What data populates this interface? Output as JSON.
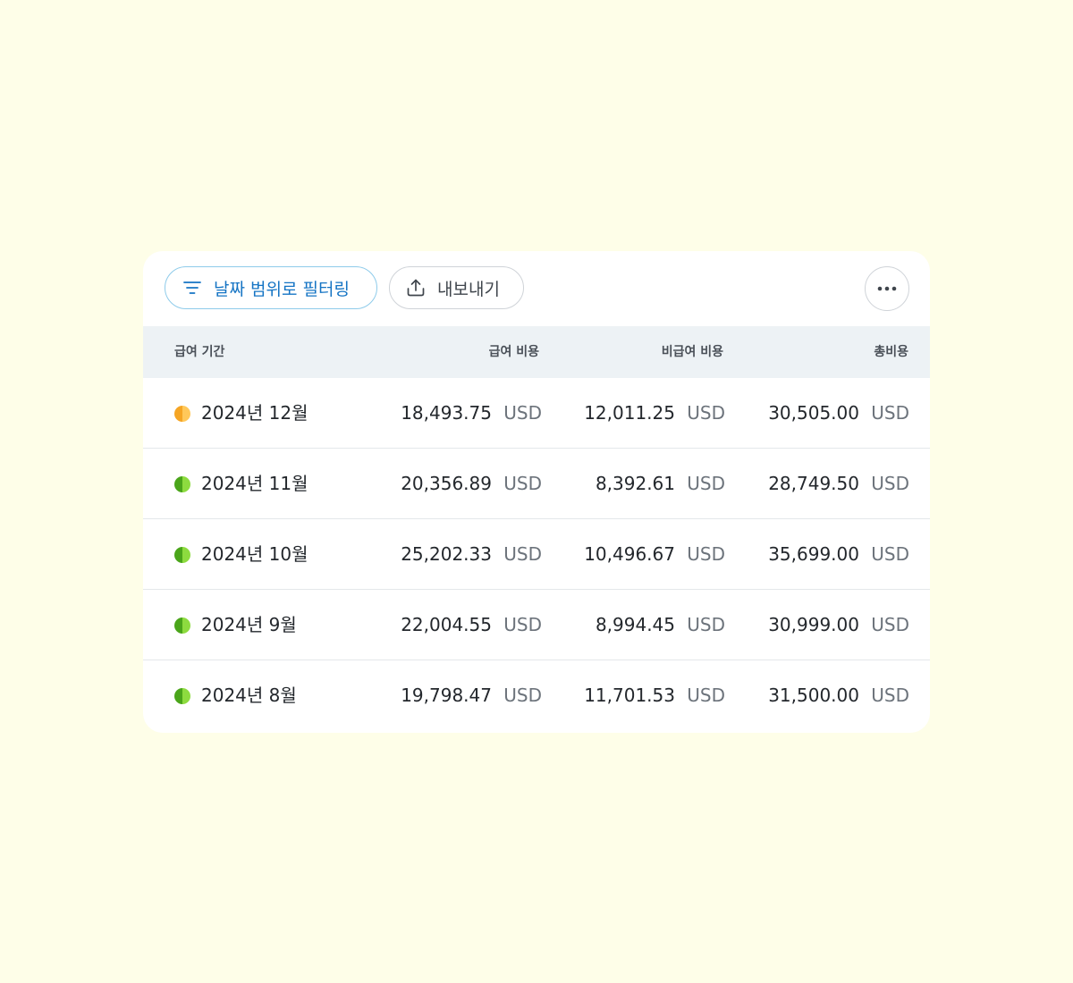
{
  "toolbar": {
    "filter_label": "날짜 범위로 필터링",
    "export_label": "내보내기",
    "filter_icon": "filter-icon",
    "export_icon": "upload-icon",
    "more_icon": "more-horizontal-icon"
  },
  "table": {
    "columns": [
      "급여 기간",
      "급여 비용",
      "비급여 비용",
      "총비용"
    ],
    "currency": "USD",
    "rows": [
      {
        "period": "2024년 12월",
        "pay": "18,493.75",
        "nonpay": "12,011.25",
        "total": "30,505.00",
        "currency": "USD",
        "status": "pending",
        "status_colors": [
          "#f5a524",
          "#ffc85a"
        ]
      },
      {
        "period": "2024년 11월",
        "pay": "20,356.89",
        "nonpay": "8,392.61",
        "total": "28,749.50",
        "currency": "USD",
        "status": "complete",
        "status_colors": [
          "#4aa51a",
          "#8ddb3f"
        ]
      },
      {
        "period": "2024년 10월",
        "pay": "25,202.33",
        "nonpay": "10,496.67",
        "total": "35,699.00",
        "currency": "USD",
        "status": "complete",
        "status_colors": [
          "#4aa51a",
          "#8ddb3f"
        ]
      },
      {
        "period": "2024년 9월",
        "pay": "22,004.55",
        "nonpay": "8,994.45",
        "total": "30,999.00",
        "currency": "USD",
        "status": "complete",
        "status_colors": [
          "#4aa51a",
          "#8ddb3f"
        ]
      },
      {
        "period": "2024년 8월",
        "pay": "19,798.47",
        "nonpay": "11,701.53",
        "total": "31,500.00",
        "currency": "USD",
        "status": "complete",
        "status_colors": [
          "#4aa51a",
          "#8ddb3f"
        ]
      }
    ]
  },
  "colors": {
    "background": "#fefee8",
    "accent": "#1574c4",
    "header_bg": "#edf2f5"
  }
}
